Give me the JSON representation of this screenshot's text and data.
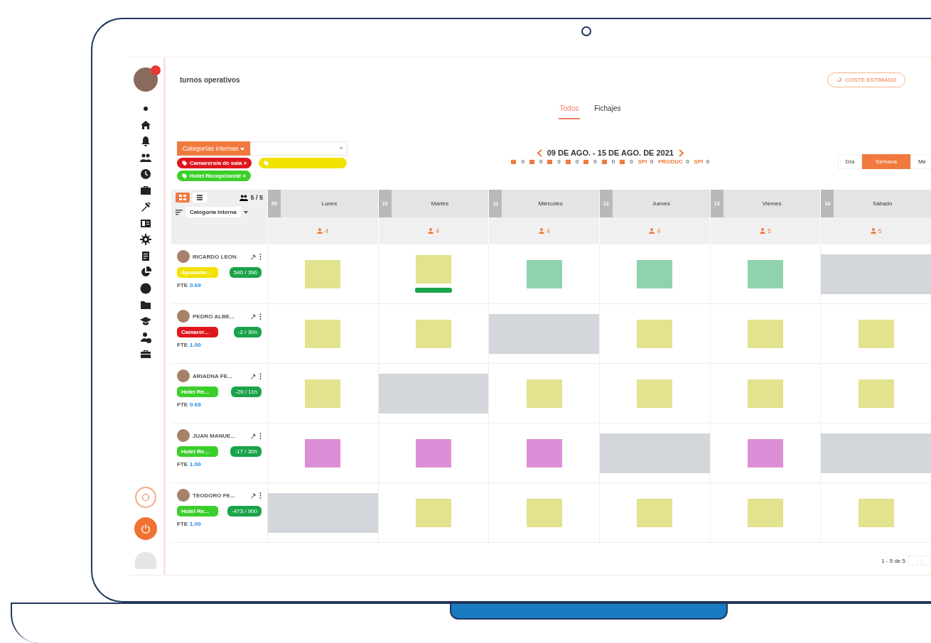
{
  "page_title": "turnos operativos",
  "cost_button": "COSTE ESTIMADO",
  "tabs": [
    {
      "label": "Todos",
      "selected": true
    },
    {
      "label": "Fichajes",
      "selected": false
    }
  ],
  "sidebar": {
    "items": [
      {
        "kind": "dot"
      },
      {
        "kind": "home"
      },
      {
        "kind": "bell"
      },
      {
        "kind": "people"
      },
      {
        "kind": "clock"
      },
      {
        "kind": "briefcase"
      },
      {
        "kind": "tools"
      },
      {
        "kind": "card"
      },
      {
        "kind": "gear"
      },
      {
        "kind": "clipboard"
      },
      {
        "kind": "pie"
      },
      {
        "kind": "chat"
      },
      {
        "kind": "folder"
      },
      {
        "kind": "cap"
      },
      {
        "kind": "user-clock"
      },
      {
        "kind": "toolbox"
      }
    ]
  },
  "filter": {
    "button": "Categorías internas",
    "tags": [
      {
        "label": "Camarero/a de sala ×",
        "color": "#e0161d"
      },
      {
        "color": "#f2e200"
      },
      {
        "label": "Hotel Recepcionist ×",
        "color": "#3ccf2c"
      }
    ]
  },
  "week": {
    "range": "09 DE AGO. - 15 DE AGO. DE 2021",
    "counters": [
      {
        "value": "0"
      },
      {
        "value": "0"
      },
      {
        "value": "0"
      },
      {
        "value": "0"
      },
      {
        "value": "0"
      },
      {
        "value": "0"
      },
      {
        "value": "0"
      }
    ],
    "labeled": [
      {
        "label": "SPI",
        "value": "0"
      },
      {
        "label": "PRODUC",
        "value": "0"
      },
      {
        "label": "SPI",
        "value": "0"
      }
    ]
  },
  "views": [
    {
      "label": "Día",
      "selected": false
    },
    {
      "label": "Semana",
      "selected": true
    },
    {
      "label": "Me",
      "selected": false
    }
  ],
  "grid": {
    "headcount": "5 / 5",
    "sort": "Categoría interna",
    "days": [
      {
        "number": "09",
        "name": "Lunes",
        "staff": "4"
      },
      {
        "number": "10",
        "name": "Martes",
        "staff": "4"
      },
      {
        "number": "11",
        "name": "Miércoles",
        "staff": "4"
      },
      {
        "number": "12",
        "name": "Jueves",
        "staff": "4"
      },
      {
        "number": "13",
        "name": "Viernes",
        "staff": "5"
      },
      {
        "number": "14",
        "name": "Sábado",
        "staff": "5"
      }
    ],
    "employees": [
      {
        "name": "RICARDO LEON",
        "category": {
          "label": "Ayudante...",
          "color": "#f2e200"
        },
        "balance": "540 / 396",
        "fte_label": "FTE",
        "fte": "0.69",
        "cells": [
          {
            "kind": "shift",
            "color": "#e2e28f"
          },
          {
            "kind": "shift",
            "color": "#e2e28f",
            "marked": true
          },
          {
            "kind": "shift",
            "color": "#8fd3ad"
          },
          {
            "kind": "shift",
            "color": "#8fd3ad"
          },
          {
            "kind": "shift",
            "color": "#8fd3ad"
          },
          {
            "kind": "off"
          }
        ]
      },
      {
        "name": "PEDRO ALBE...",
        "category": {
          "label": "Camarer...",
          "color": "#e0161d"
        },
        "balance": "-2 / 30h",
        "fte_label": "FTE",
        "fte": "1.00",
        "cells": [
          {
            "kind": "shift",
            "color": "#e2e28f"
          },
          {
            "kind": "shift",
            "color": "#e2e28f"
          },
          {
            "kind": "off"
          },
          {
            "kind": "shift",
            "color": "#e2e28f"
          },
          {
            "kind": "shift",
            "color": "#e2e28f"
          },
          {
            "kind": "shift",
            "color": "#e2e28f"
          }
        ]
      },
      {
        "name": "ARIADNA FE...",
        "category": {
          "label": "Hotel Re...",
          "color": "#3ccf2c"
        },
        "balance": "-20 / 11h",
        "fte_label": "FTE",
        "fte": "0.69",
        "cells": [
          {
            "kind": "shift",
            "color": "#e2e28f"
          },
          {
            "kind": "off"
          },
          {
            "kind": "shift",
            "color": "#e2e28f"
          },
          {
            "kind": "shift",
            "color": "#e2e28f"
          },
          {
            "kind": "shift",
            "color": "#e2e28f"
          },
          {
            "kind": "shift",
            "color": "#e2e28f"
          }
        ]
      },
      {
        "name": "JUAN MANUE...",
        "category": {
          "label": "Hotel Re...",
          "color": "#3ccf2c"
        },
        "balance": "-17 / 30h",
        "fte_label": "FTE",
        "fte": "1.00",
        "cells": [
          {
            "kind": "shift",
            "color": "#dc8fd6"
          },
          {
            "kind": "shift",
            "color": "#dc8fd6"
          },
          {
            "kind": "shift",
            "color": "#dc8fd6"
          },
          {
            "kind": "off"
          },
          {
            "kind": "shift",
            "color": "#dc8fd6"
          },
          {
            "kind": "off"
          }
        ]
      },
      {
        "name": "TEODORO FE...",
        "category": {
          "label": "Hotel Re...",
          "color": "#3ccf2c"
        },
        "balance": "-473 / 900",
        "fte_label": "FTE",
        "fte": "1.00",
        "cells": [
          {
            "kind": "off"
          },
          {
            "kind": "shift",
            "color": "#e2e28f"
          },
          {
            "kind": "shift",
            "color": "#e2e28f"
          },
          {
            "kind": "shift",
            "color": "#e2e28f"
          },
          {
            "kind": "shift",
            "color": "#e2e28f"
          },
          {
            "kind": "shift",
            "color": "#e2e28f"
          }
        ]
      }
    ]
  },
  "pagination": "1 - 5 de 5"
}
